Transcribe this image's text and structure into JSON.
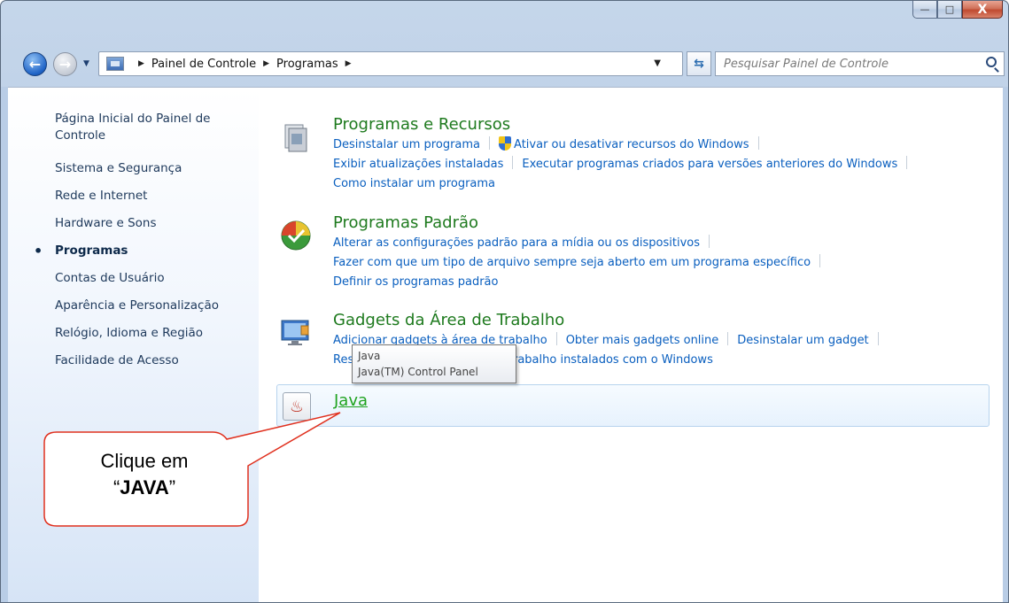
{
  "window": {
    "caption_buttons": {
      "minimize": "—",
      "maximize": "□",
      "close": "X"
    }
  },
  "navigation": {
    "back_glyph": "←",
    "forward_glyph": "→",
    "breadcrumb": [
      "Painel de Controle",
      "Programas"
    ],
    "search_placeholder": "Pesquisar Painel de Controle",
    "refresh_glyph": "⇆"
  },
  "sidebar": {
    "items": [
      {
        "label": "Página Inicial do Painel de Controle",
        "active": false
      },
      {
        "label": "Sistema e Segurança",
        "active": false
      },
      {
        "label": "Rede e Internet",
        "active": false
      },
      {
        "label": "Hardware e Sons",
        "active": false
      },
      {
        "label": "Programas",
        "active": true
      },
      {
        "label": "Contas de Usuário",
        "active": false
      },
      {
        "label": "Aparência e Personalização",
        "active": false
      },
      {
        "label": "Relógio, Idioma e Região",
        "active": false
      },
      {
        "label": "Facilidade de Acesso",
        "active": false
      }
    ]
  },
  "sections": [
    {
      "title": "Programas e Recursos",
      "icon": "programs-features-icon",
      "links": [
        "Desinstalar um programa",
        "Ativar ou desativar recursos do Windows",
        "Exibir atualizações instaladas",
        "Executar programas criados para versões anteriores do Windows",
        "Como instalar um programa"
      ]
    },
    {
      "title": "Programas Padrão",
      "icon": "default-programs-icon",
      "links": [
        "Alterar as configurações padrão para a mídia ou os dispositivos",
        "Fazer com que um tipo de arquivo sempre seja aberto em um programa específico",
        "Definir os programas padrão"
      ]
    },
    {
      "title": "Gadgets da Área de Trabalho",
      "icon": "desktop-gadgets-icon",
      "links": [
        "Adicionar gadgets à área de trabalho",
        "Obter mais gadgets online",
        "Desinstalar um gadget",
        "Restaurar gadgets da área de trabalho instalados com o Windows"
      ]
    }
  ],
  "java": {
    "title": "Java",
    "tooltip_line1": "Java",
    "tooltip_line2": "Java(TM) Control Panel"
  },
  "callout": {
    "line1": "Clique em",
    "quote_open": "“",
    "bold": "JAVA",
    "quote_close": "”"
  },
  "colors": {
    "section_title": "#1e7a1e",
    "link": "#0a5fbf",
    "java_link": "#1fa31f",
    "callout_border": "#e0301e"
  }
}
